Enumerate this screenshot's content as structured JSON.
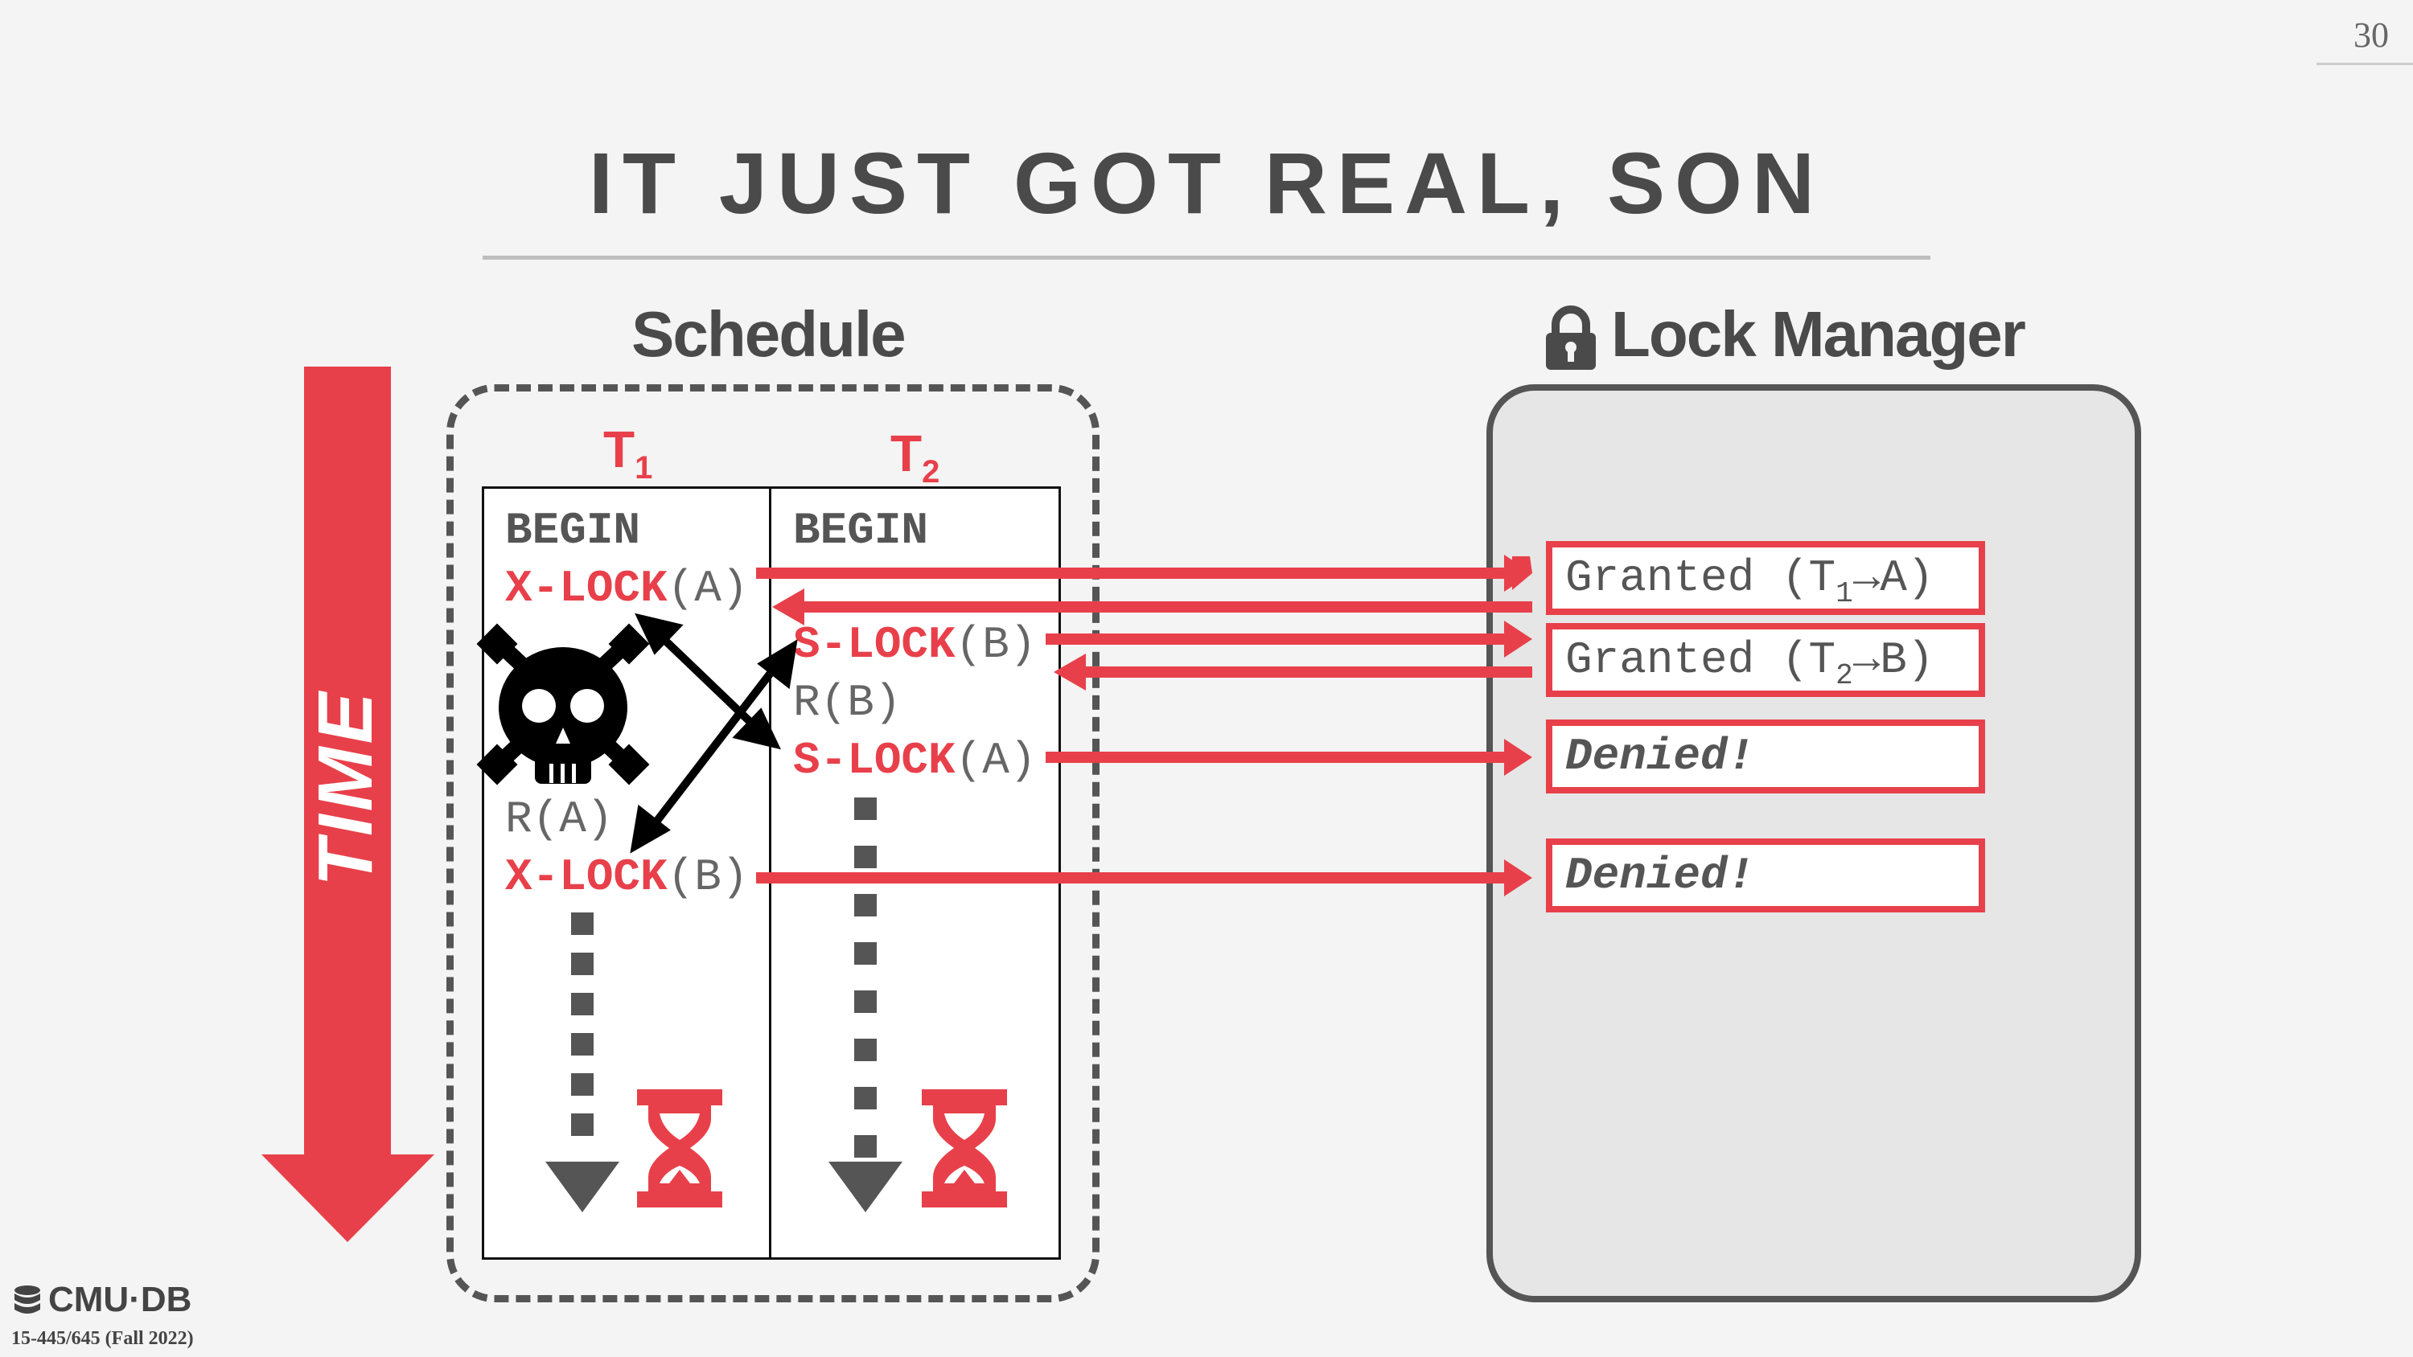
{
  "page_number": "30",
  "title": "IT JUST GOT REAL, SON",
  "schedule_heading": "Schedule",
  "lock_manager_heading": "Lock Manager",
  "time_label": "TIME",
  "transactions": {
    "t1": {
      "label": "T",
      "sub": "1"
    },
    "t2": {
      "label": "T",
      "sub": "2"
    }
  },
  "t1_ops": {
    "begin": "BEGIN",
    "xlock_a_kw": "X-LOCK",
    "xlock_a_arg": "(A)",
    "read_a": "R(A)",
    "xlock_b_kw": "X-LOCK",
    "xlock_b_arg": "(B)"
  },
  "t2_ops": {
    "begin": "BEGIN",
    "slock_b_kw": "S-LOCK",
    "slock_b_arg": "(B)",
    "read_b": "R(B)",
    "slock_a_kw": "S-LOCK",
    "slock_a_arg": "(A)"
  },
  "lock_manager": {
    "granted1": {
      "prefix": "Granted (T",
      "sub": "1",
      "suffix": "→A)"
    },
    "granted2": {
      "prefix": "Granted (T",
      "sub": "2",
      "suffix": "→B)"
    },
    "denied1": "Denied!",
    "denied2": "Denied!"
  },
  "footer": {
    "logo": "CMU·DB",
    "course": "15-445/645 (Fall 2022)"
  },
  "colors": {
    "accent": "#e8404a",
    "dark": "#4a4a4a",
    "background": "#f4f4f4"
  },
  "icons": [
    "lock-icon",
    "skull-crossbones-icon",
    "hourglass-icon",
    "database-icon"
  ]
}
